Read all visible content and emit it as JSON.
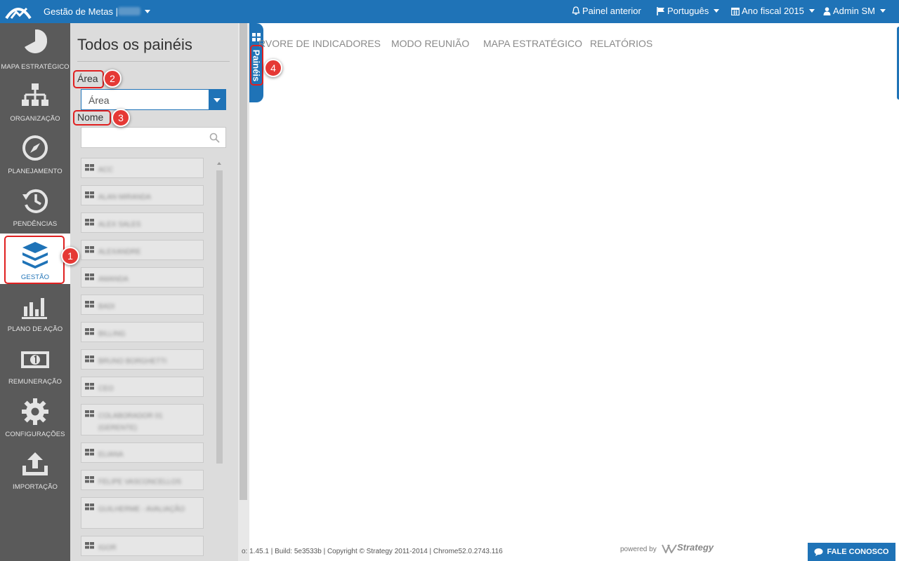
{
  "topbar": {
    "app_title": "Gestão de Metas |",
    "previous_panel": "Painel anterior",
    "language": "Português",
    "fiscal_year": "Ano fiscal 2015",
    "user": "Admin SM"
  },
  "leftnav": {
    "items": [
      {
        "label": "MAPA ESTRATÉGICO",
        "icon": "pie-chart-icon"
      },
      {
        "label": "ORGANIZAÇÃO",
        "icon": "org-chart-icon"
      },
      {
        "label": "PLANEJAMENTO",
        "icon": "compass-icon"
      },
      {
        "label": "PENDÊNCIAS",
        "icon": "history-icon"
      },
      {
        "label": "GESTÃO",
        "icon": "layers-icon",
        "active": true
      },
      {
        "label": "PLANO DE AÇÃO",
        "icon": "bar-chart-icon"
      },
      {
        "label": "REMUNERAÇÃO",
        "icon": "money-icon"
      },
      {
        "label": "CONFIGURAÇÕES",
        "icon": "gear-icon"
      },
      {
        "label": "IMPORTAÇÃO",
        "icon": "upload-icon"
      }
    ]
  },
  "panel": {
    "title": "Todos os painéis",
    "area_label": "Área",
    "area_select_value": "Área",
    "name_label": "Nome",
    "name_placeholder": "",
    "items": [
      "ACC",
      "ALAN MIRANDA",
      "ALEX SALES",
      "ALEXANDRE",
      "AMANDA",
      "BADI",
      "BILLING",
      "BRUNO BORGHETTI",
      "CEO",
      "COLABORADOR 01 (GERENTE)",
      "ELIANA",
      "FELIPE VASCONCELLOS",
      "GUILHERME - AVALIAÇÃO",
      "IGOR"
    ]
  },
  "paineis_tab": {
    "label": "Painéis"
  },
  "main_tabs": [
    "RVORE DE INDICADORES",
    "MODO REUNIÃO",
    "MAPA ESTRATÉGICO",
    "RELATÓRIOS"
  ],
  "footer": {
    "version_text": "o: 1.45.1 | Build: 5e3533b | Copyright © Strategy 2011-2014 | Chrome52.0.2743.116",
    "powered_by": "powered by",
    "brand": "Strategy",
    "contact_button": "FALE CONOSCO"
  },
  "callouts": [
    "1",
    "2",
    "3",
    "4"
  ],
  "colors": {
    "brand_blue": "#1f73b7",
    "nav_bg": "#5a5a5a",
    "panel_bg": "#dcdcdc",
    "callout_red": "#e53935"
  }
}
